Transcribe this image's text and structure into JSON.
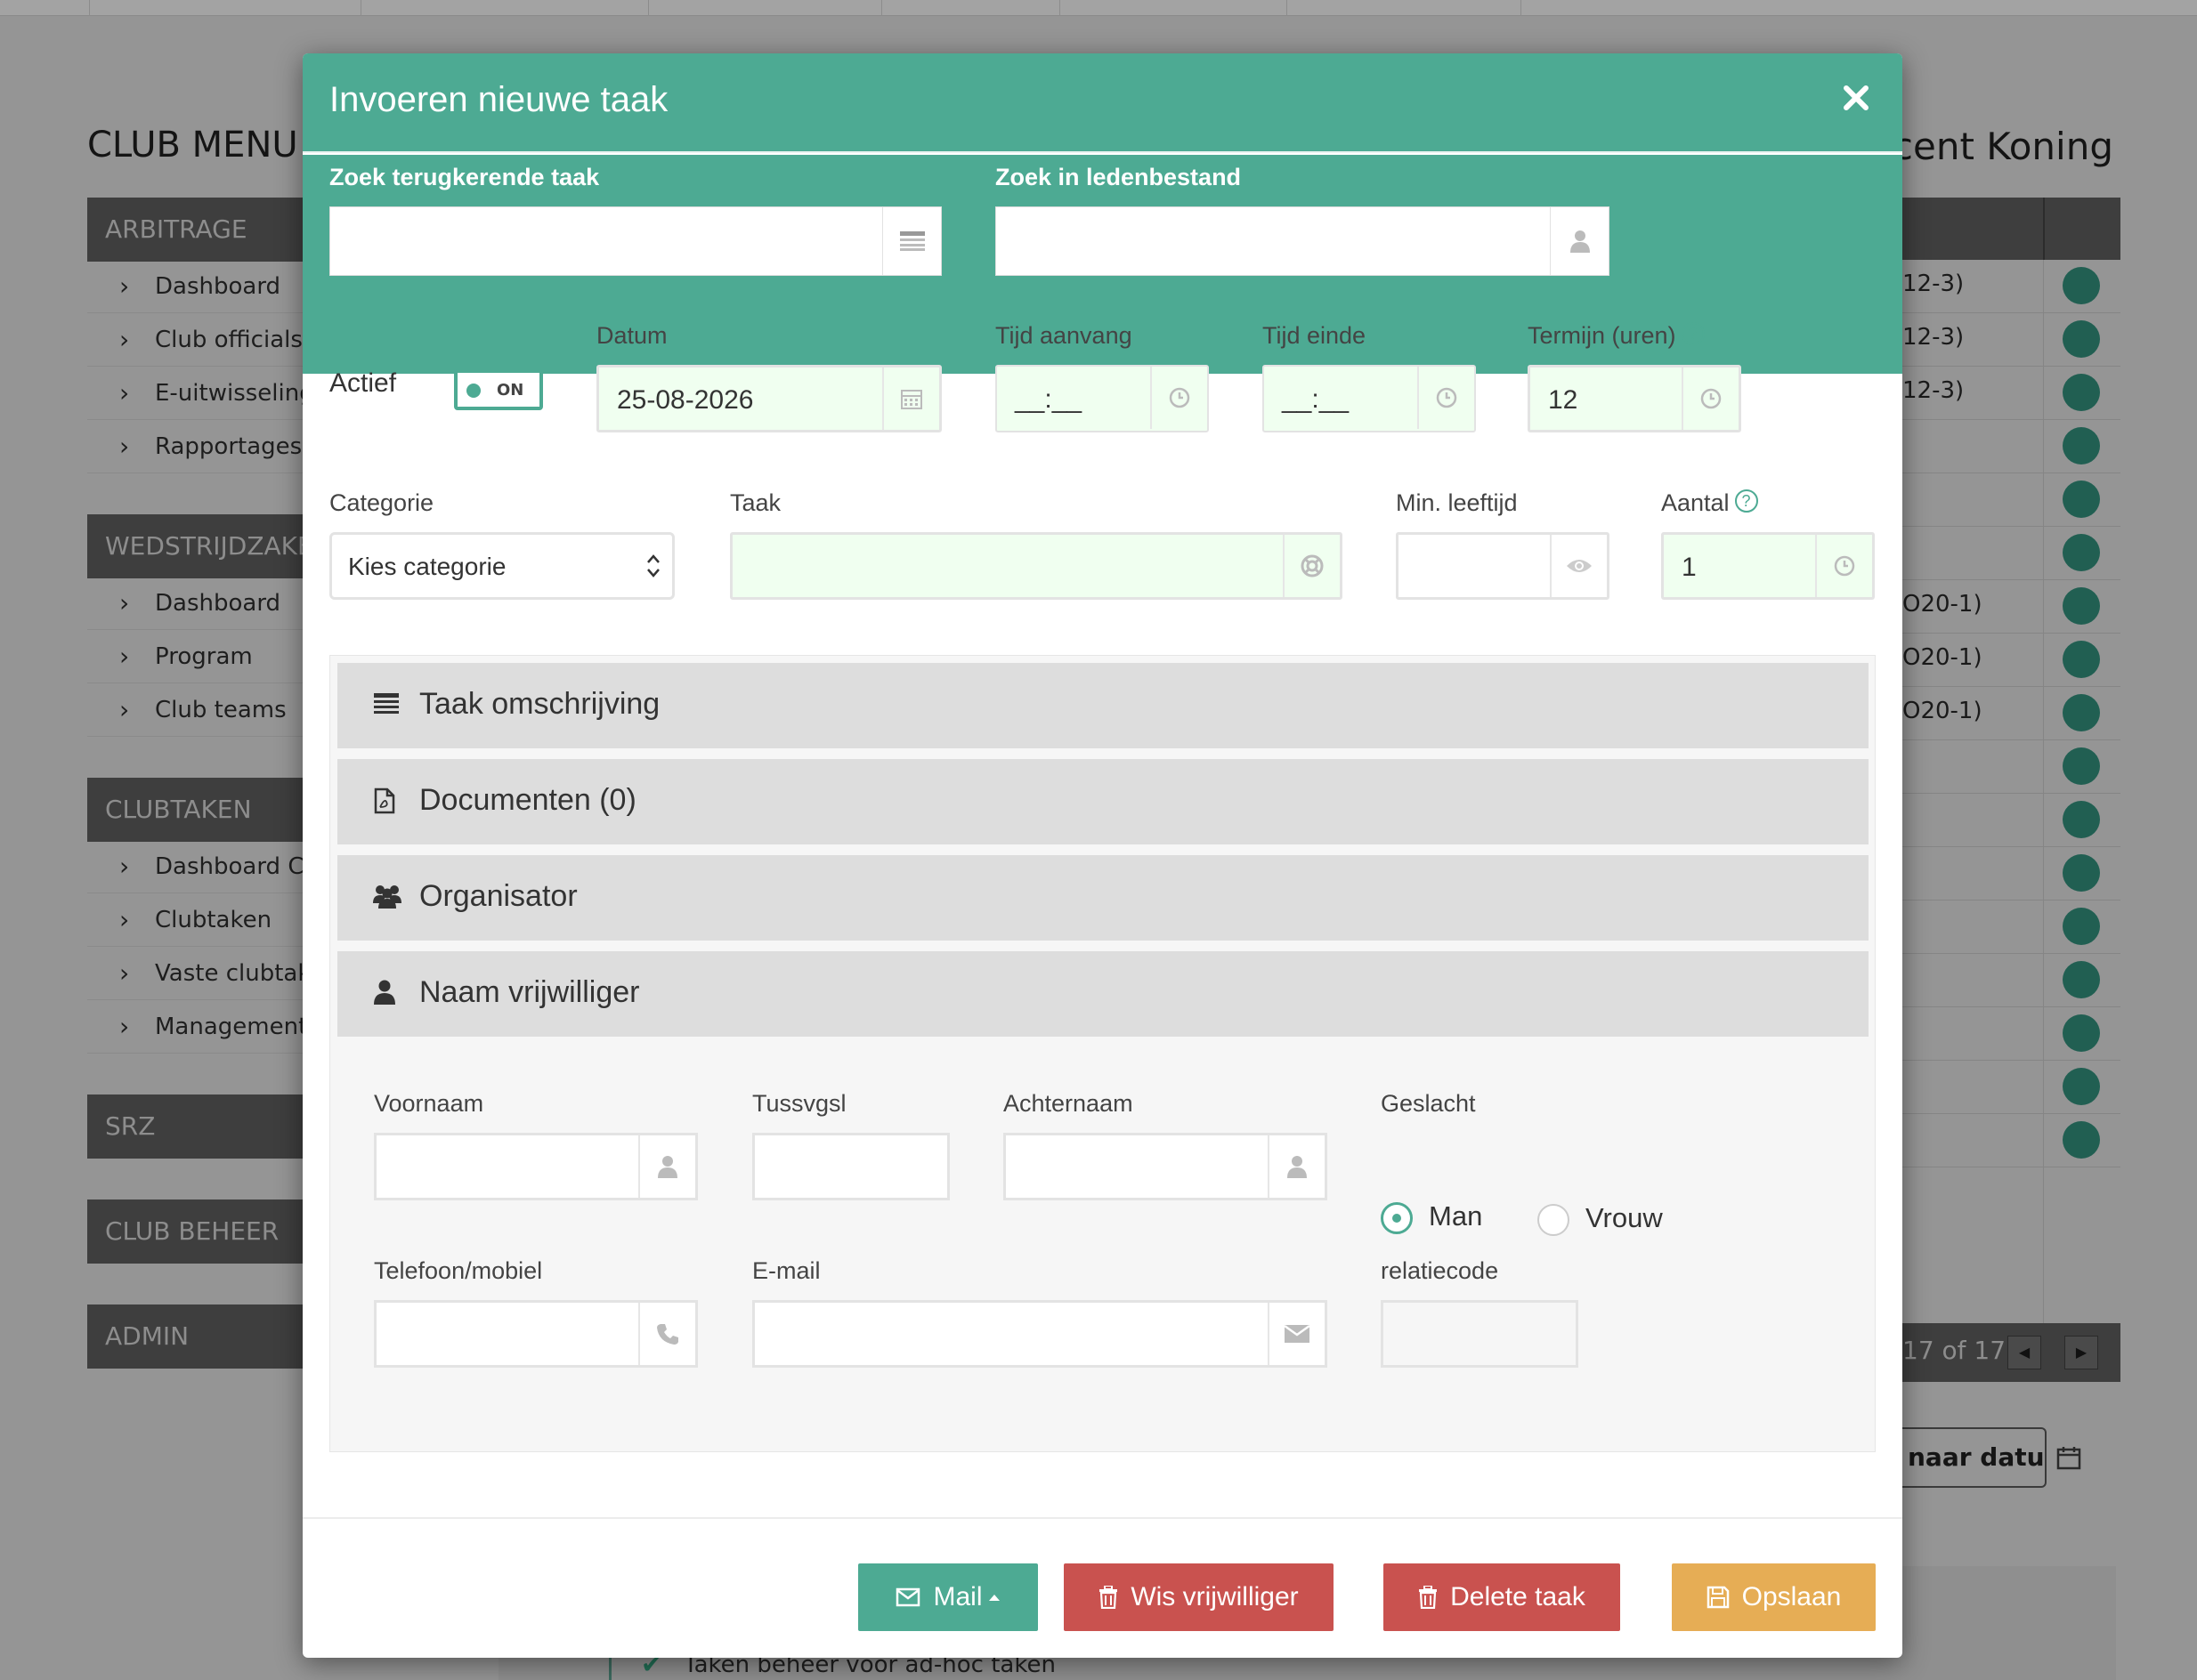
{
  "background": {
    "club_menu_title": "CLUB MENU",
    "user_name": "Vincent Koning",
    "menu": [
      {
        "header": "ARBITRAGE",
        "items": [
          "Dashboard",
          "Club officials",
          "E-uitwisseling",
          "Rapportages"
        ]
      },
      {
        "header": "WEDSTRIJDZAKEN",
        "items": [
          "Dashboard",
          "Program",
          "Club teams"
        ]
      },
      {
        "header": "CLUBTAKEN",
        "items": [
          "Dashboard Clubtaken",
          "Clubtaken",
          "Vaste clubtaken",
          "Management"
        ]
      },
      {
        "header": "SRZ",
        "items": []
      },
      {
        "header": "CLUB BEHEER",
        "items": []
      },
      {
        "header": "ADMIN",
        "items": []
      }
    ],
    "table_rows": [
      "12-3)",
      "12-3)",
      "12-3)",
      "",
      "",
      "",
      "O20-1)",
      "O20-1)",
      "O20-1)",
      "",
      "",
      "",
      "",
      "",
      "",
      "",
      ""
    ],
    "pager_text": "17 of 17",
    "date_button": "naar datum",
    "bottom_text": "Taken beheer voor ad-hoc taken"
  },
  "modal": {
    "title": "Invoeren nieuwe taak",
    "search_task_label": "Zoek terugkerende taak",
    "search_member_label": "Zoek in ledenbestand",
    "actief_label": "Actief",
    "toggle_text": "ON",
    "datum_label": "Datum",
    "datum_value": "25-08-2026",
    "tijd_aanvang_label": "Tijd aanvang",
    "tijd_aanvang_value": "__:__",
    "tijd_einde_label": "Tijd einde",
    "tijd_einde_value": "__:__",
    "termijn_label": "Termijn (uren)",
    "termijn_value": "12",
    "categorie_label": "Categorie",
    "categorie_value": "Kies categorie",
    "taak_label": "Taak",
    "min_leeftijd_label": "Min. leeftijd",
    "aantal_label": "Aantal",
    "aantal_value": "1",
    "help_mark": "?",
    "accordion": [
      "Taak omschrijving",
      "Documenten (0)",
      "Organisator",
      "Naam vrijwilliger"
    ],
    "volunteer": {
      "voornaam_label": "Voornaam",
      "tussvgsl_label": "Tussvgsl",
      "achternaam_label": "Achternaam",
      "geslacht_label": "Geslacht",
      "man_label": "Man",
      "vrouw_label": "Vrouw",
      "selected_gender": "Man",
      "telefoon_label": "Telefoon/mobiel",
      "email_label": "E-mail",
      "relatiecode_label": "relatiecode"
    },
    "buttons": {
      "mail": "Mail",
      "wis": "Wis vrijwilliger",
      "delete": "Delete taak",
      "save": "Opslaan"
    }
  },
  "colors": {
    "accent": "#4daa93",
    "danger": "#c9524f",
    "warning": "#e6ad55",
    "overlay": "#959595"
  }
}
